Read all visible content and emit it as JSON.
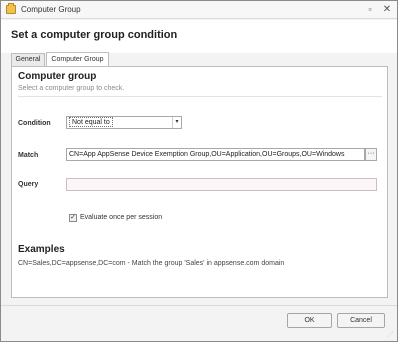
{
  "window": {
    "title": "Computer Group",
    "restore_glyph": "▫",
    "close_glyph": "✕"
  },
  "header": {
    "title": "Set a computer group condition"
  },
  "tabs": [
    {
      "label": "General",
      "active": false
    },
    {
      "label": "Computer Group",
      "active": true
    }
  ],
  "section": {
    "title": "Computer group",
    "subtitle": "Select a computer group to check."
  },
  "form": {
    "condition_label": "Condition",
    "condition_value": "Not equal to",
    "condition_arrow": "▾",
    "match_label": "Match",
    "match_value": "CN=App AppSense Device Exemption Group,OU=Application,OU=Groups,OU=Windows",
    "browse_label": "···",
    "query_label": "Query",
    "query_value": "",
    "evaluate_label": "Evaluate once per session",
    "evaluate_checked": true,
    "check_glyph": "✓"
  },
  "examples": {
    "title": "Examples",
    "text": "CN=Sales,DC=appsense,DC=com - Match the group 'Sales' in appsense.com domain"
  },
  "footer": {
    "ok_label": "OK",
    "cancel_label": "Cancel"
  },
  "icons": {
    "app": "folder-icon",
    "restore": "restore-icon",
    "close": "close-icon",
    "dropdown": "chevron-down-icon",
    "browse": "ellipsis-icon",
    "checkbox": "checkmark-icon",
    "grip": "resize-grip-icon"
  },
  "colors": {
    "window_bg": "#f3f3f3",
    "panel_bg": "#ffffff",
    "query_field_bg": "#fbf7f9",
    "border": "#bdbdbd"
  }
}
